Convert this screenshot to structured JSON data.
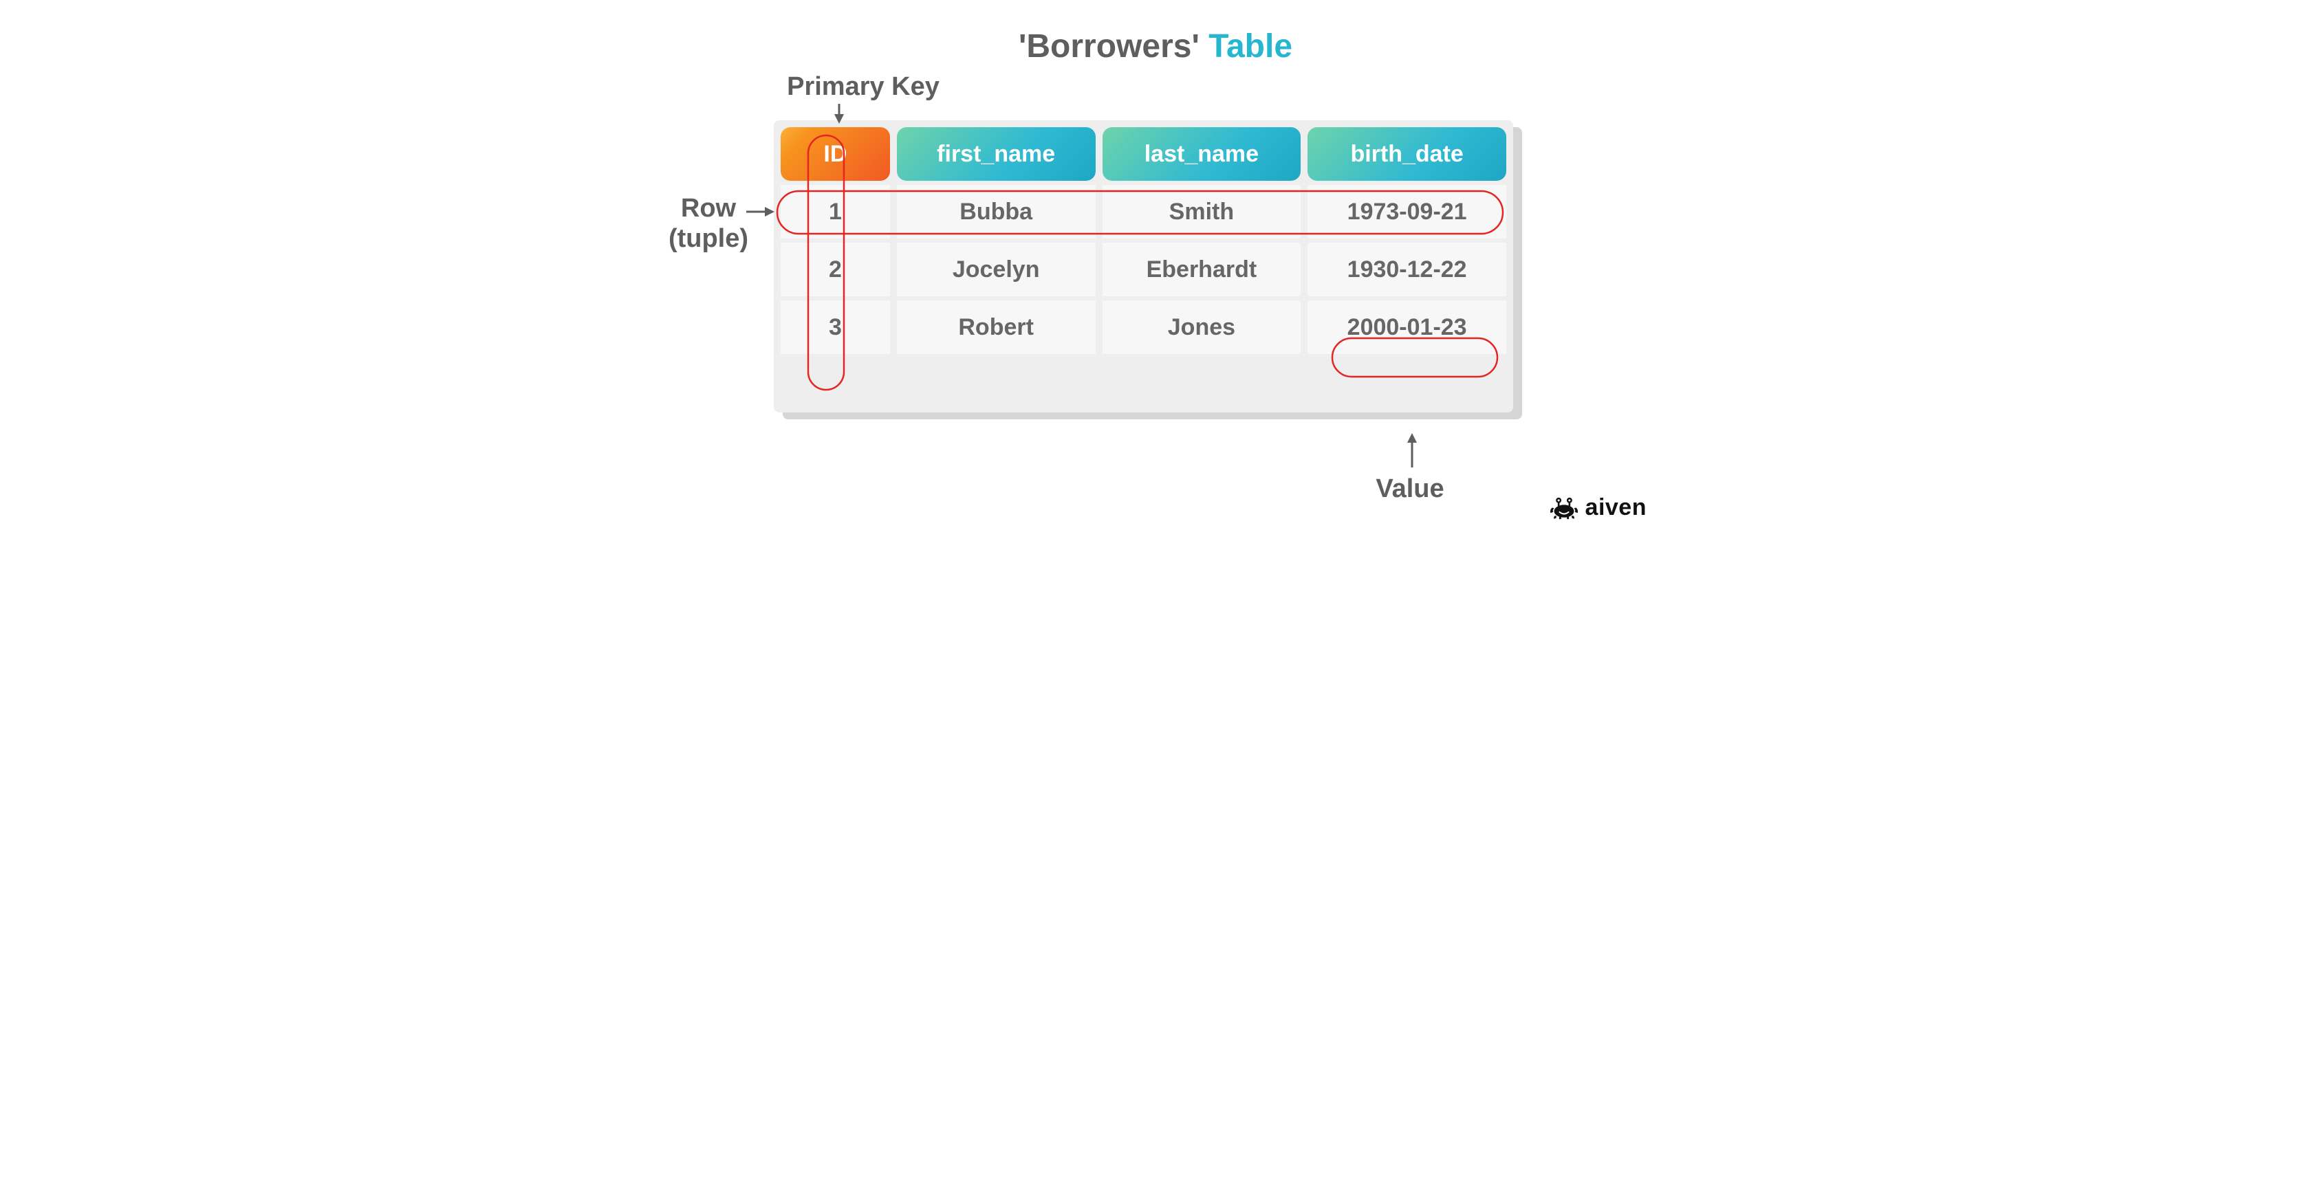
{
  "title": {
    "quoted": "'Borrowers'",
    "word": "Table"
  },
  "labels": {
    "primary_key": "Primary Key",
    "row_line1": "Row",
    "row_line2": "(tuple)",
    "value": "Value"
  },
  "table": {
    "columns": [
      "ID",
      "first_name",
      "last_name",
      "birth_date"
    ],
    "rows": [
      {
        "id": "1",
        "first_name": "Bubba",
        "last_name": "Smith",
        "birth_date": "1973-09-21"
      },
      {
        "id": "2",
        "first_name": "Jocelyn",
        "last_name": "Eberhardt",
        "birth_date": "1930-12-22"
      },
      {
        "id": "3",
        "first_name": "Robert",
        "last_name": "Jones",
        "birth_date": "2000-01-23"
      }
    ]
  },
  "annotations": {
    "primary_key_points_to_column_index": 0,
    "row_points_to_row_index": 0,
    "value_points_to": {
      "row_index": 2,
      "column_index": 3
    }
  },
  "brand": {
    "name": "aiven"
  },
  "colors": {
    "title_grey": "#5e5e5e",
    "title_teal": "#26b6cf",
    "header_orange_start": "#fbb03b",
    "header_orange_end": "#f15a24",
    "header_teal_start": "#6ed3ab",
    "header_teal_end": "#1ea7c4",
    "annotation_red": "#e52521",
    "text_grey": "#666666",
    "card_bg": "#eeeeee",
    "cell_bg": "#f7f7f7"
  }
}
